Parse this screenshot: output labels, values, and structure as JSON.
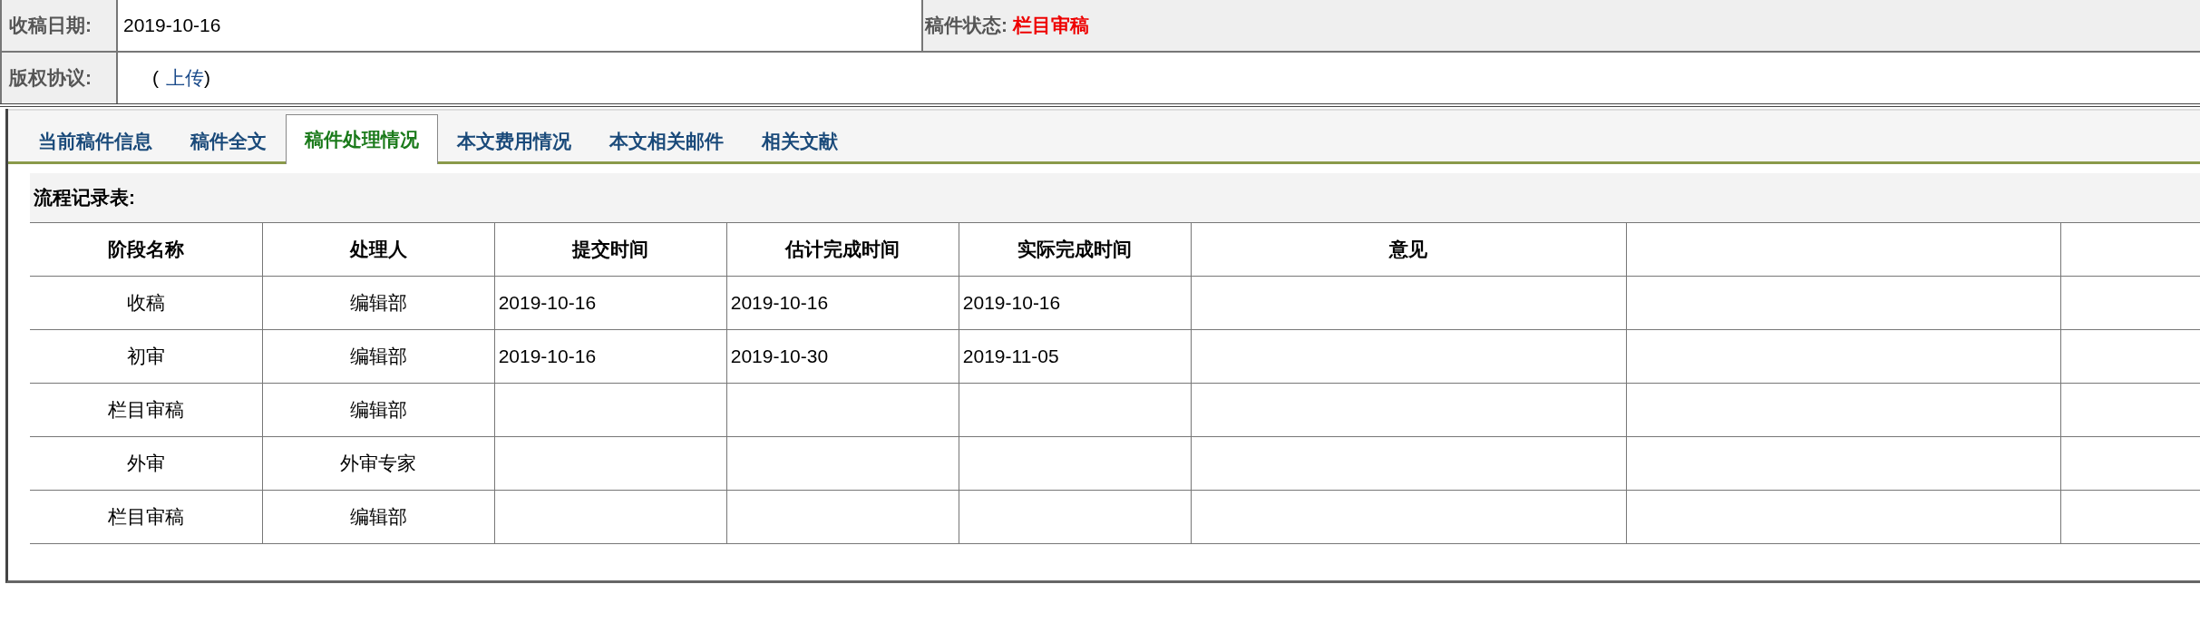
{
  "info": {
    "received_label": "收稿日期:",
    "received_date": "2019-10-16",
    "status_label": "稿件状态:",
    "status_value": "栏目审稿",
    "copyright_label": "版权协议:",
    "copyright_open": "(",
    "upload_link": "上传",
    "copyright_close": ")"
  },
  "tabs": [
    {
      "label": "当前稿件信息",
      "selected": false
    },
    {
      "label": "稿件全文",
      "selected": false
    },
    {
      "label": "稿件处理情况",
      "selected": true
    },
    {
      "label": "本文费用情况",
      "selected": false
    },
    {
      "label": "本文相关邮件",
      "selected": false
    },
    {
      "label": "相关文献",
      "selected": false
    }
  ],
  "panel_title": "流程记录表:",
  "table": {
    "columns": [
      "阶段名称",
      "处理人",
      "提交时间",
      "估计完成时间",
      "实际完成时间",
      "意见"
    ],
    "rows": [
      [
        "收稿",
        "编辑部",
        "2019-10-16",
        "2019-10-16",
        "2019-10-16"
      ],
      [
        "初审",
        "编辑部",
        "2019-10-16",
        "2019-10-30",
        "2019-11-05"
      ],
      [
        "栏目审稿",
        "编辑部"
      ],
      [
        "外审",
        "外审专家"
      ],
      [
        "栏目审稿",
        "编辑部"
      ]
    ]
  }
}
